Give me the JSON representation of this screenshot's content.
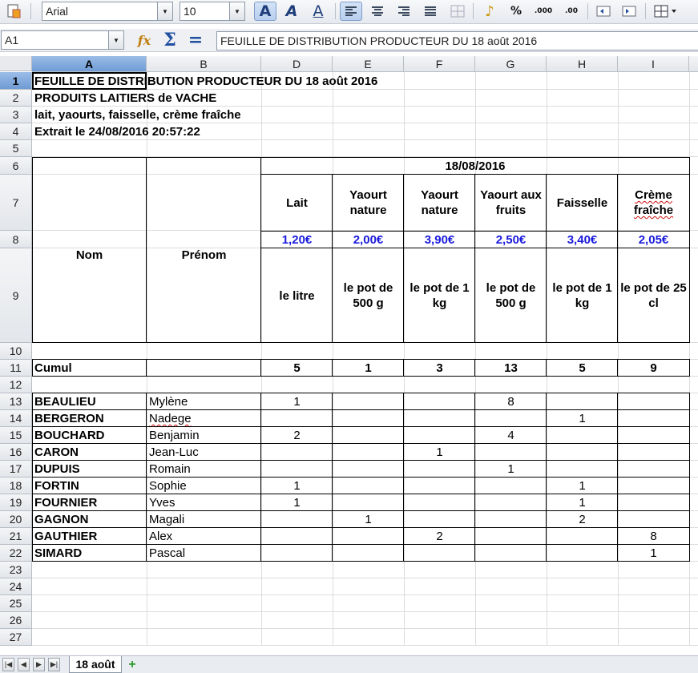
{
  "toolbar": {
    "font_name": "Arial",
    "font_size": "10",
    "items": [
      "styles-icon",
      "bold-icon",
      "italic-icon",
      "underline-icon",
      "align-left-icon",
      "align-center-icon",
      "align-right-icon",
      "justify-icon",
      "merge-cells-icon",
      "currency-icon",
      "percent-icon",
      "add-decimal-icon",
      "remove-decimal-icon",
      "decrease-indent-icon",
      "increase-indent-icon",
      "borders-icon"
    ],
    "percent_label": "%",
    "add_decimal_label": ".000",
    "remove_decimal_label": ".00"
  },
  "formula_bar": {
    "cell_ref": "A1",
    "content": "FEUILLE DE DISTRIBUTION PRODUCTEUR DU 18 août 2016",
    "fx_label": "fx",
    "sum_label": "Σ",
    "equal_label": "="
  },
  "columns": [
    "A",
    "B",
    "D",
    "E",
    "F",
    "G",
    "H",
    "I"
  ],
  "rows": [
    "1",
    "2",
    "3",
    "4",
    "5",
    "6",
    "7",
    "8",
    "9",
    "10",
    "11",
    "12",
    "13",
    "14",
    "15",
    "16",
    "17",
    "18",
    "19",
    "20",
    "21",
    "22",
    "23",
    "24",
    "25",
    "26",
    "27"
  ],
  "sheet": {
    "title": "FEUILLE DE DISTRIBUTION PRODUCTEUR DU 18 août 2016",
    "subtitle": "PRODUITS LAITIERS de VACHE",
    "products_line": "lait, yaourts, faisselle, crème fraîche",
    "extract": "Extrait le 24/08/2016 20:57:22",
    "header_nom": "Nom",
    "header_prenom": "Prénom",
    "date": "18/08/2016",
    "products": [
      {
        "name": "Lait",
        "price": "1,20€",
        "unit": "le litre"
      },
      {
        "name": "Yaourt nature",
        "price": "2,00€",
        "unit": "le pot de 500 g"
      },
      {
        "name": "Yaourt nature",
        "price": "3,90€",
        "unit": "le pot de 1 kg"
      },
      {
        "name": "Yaourt aux fruits",
        "price": "2,50€",
        "unit": "le pot de 500 g"
      },
      {
        "name": "Faisselle",
        "price": "3,40€",
        "unit": "le pot de 1 kg"
      },
      {
        "name": "Crème fraîche",
        "price": "2,05€",
        "unit": "le pot de 25 cl"
      }
    ],
    "cumul_label": "Cumul",
    "cumul": [
      "5",
      "1",
      "3",
      "13",
      "5",
      "9"
    ],
    "people": [
      {
        "nom": "BEAULIEU",
        "prenom": "Mylène",
        "qty": [
          "1",
          "",
          "",
          "8",
          "",
          ""
        ]
      },
      {
        "nom": "BERGERON",
        "prenom": "Nadege",
        "qty": [
          "",
          "",
          "",
          "",
          "1",
          ""
        ]
      },
      {
        "nom": "BOUCHARD",
        "prenom": "Benjamin",
        "qty": [
          "2",
          "",
          "",
          "4",
          "",
          ""
        ]
      },
      {
        "nom": "CARON",
        "prenom": "Jean-Luc",
        "qty": [
          "",
          "",
          "1",
          "",
          "",
          ""
        ]
      },
      {
        "nom": "DUPUIS",
        "prenom": "Romain",
        "qty": [
          "",
          "",
          "",
          "1",
          "",
          ""
        ]
      },
      {
        "nom": "FORTIN",
        "prenom": "Sophie",
        "qty": [
          "1",
          "",
          "",
          "",
          "1",
          ""
        ]
      },
      {
        "nom": "FOURNIER",
        "prenom": "Yves",
        "qty": [
          "1",
          "",
          "",
          "",
          "1",
          ""
        ]
      },
      {
        "nom": "GAGNON",
        "prenom": "Magali",
        "qty": [
          "",
          "1",
          "",
          "",
          "2",
          ""
        ]
      },
      {
        "nom": "GAUTHIER",
        "prenom": "Alex",
        "qty": [
          "",
          "",
          "2",
          "",
          "",
          "8"
        ]
      },
      {
        "nom": "SIMARD",
        "prenom": "Pascal",
        "qty": [
          "",
          "",
          "",
          "",
          "",
          "1"
        ]
      }
    ]
  },
  "tabs": {
    "active": "18 août",
    "add_label": "+",
    "nav": [
      "first-sheet-icon",
      "prev-sheet-icon",
      "next-sheet-icon",
      "last-sheet-icon"
    ]
  },
  "colors": {
    "price_blue": "#1a1adc",
    "selection_header": "#6f9bd4",
    "spell_error": "#d01010"
  }
}
